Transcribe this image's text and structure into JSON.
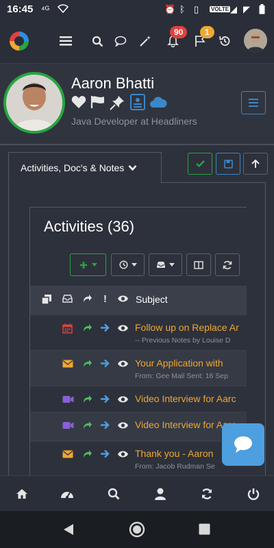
{
  "status_bar": {
    "time": "16:45",
    "network_label": "VOLTE"
  },
  "nav": {
    "notifications_count": "90",
    "flags_count": "1"
  },
  "profile": {
    "name": "Aaron Bhatti",
    "subtitle": "Java Developer at Headliners"
  },
  "tab": {
    "label": "Activities, Doc's & Notes"
  },
  "activities": {
    "title": "Activities (36)",
    "column_subject": "Subject",
    "rows": [
      {
        "type_icon": "calendar-icon",
        "type_color": "#e0413e",
        "subject": "Follow up on Replace Ar",
        "detail": "-- Previous Notes by Louise D"
      },
      {
        "type_icon": "envelope-icon",
        "type_color": "#f0a733",
        "subject": "Your Application with",
        "detail": "From: Gee Mail Sent: 16 Sep"
      },
      {
        "type_icon": "video-icon",
        "type_color": "#8a5fd6",
        "subject": "Video Interview for Aarc",
        "detail": ""
      },
      {
        "type_icon": "video-icon",
        "type_color": "#8a5fd6",
        "subject": "Video Interview for Aarc",
        "detail": ""
      },
      {
        "type_icon": "envelope-icon",
        "type_color": "#f0a733",
        "subject": "Thank you - Aaron",
        "detail": "From: Jacob Rudman Se"
      }
    ]
  },
  "colors": {
    "accent_green": "#27a541",
    "accent_blue": "#3b87c9",
    "link_orange": "#f0a733",
    "badge_red": "#e0413e",
    "badge_orange": "#f0a733"
  }
}
